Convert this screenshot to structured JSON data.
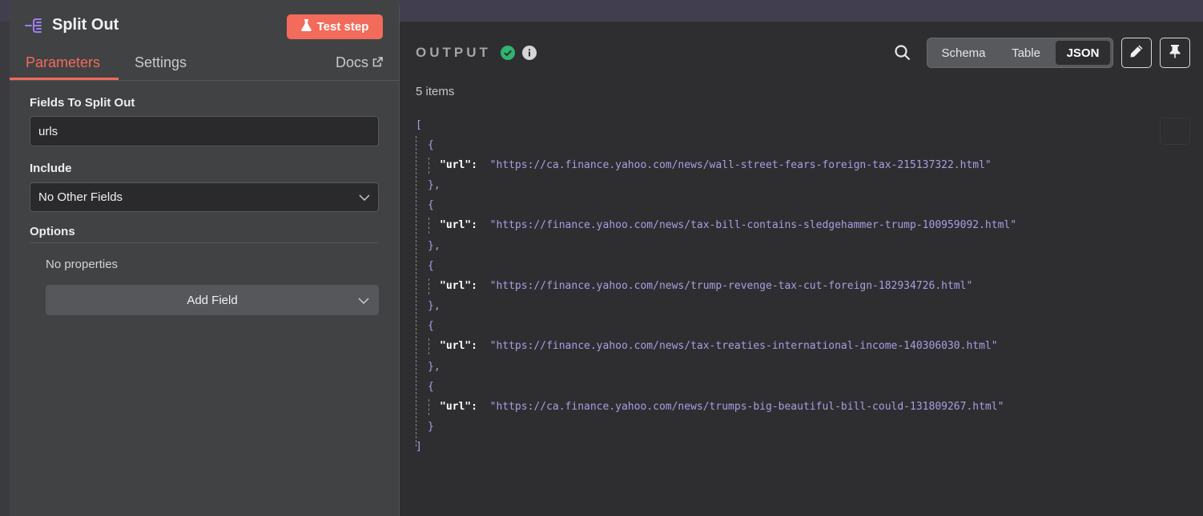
{
  "node": {
    "title": "Split Out",
    "test_step_label": "Test step",
    "tabs": [
      {
        "label": "Parameters",
        "active": true
      },
      {
        "label": "Settings",
        "active": false
      }
    ],
    "docs_label": "Docs",
    "fields": {
      "split_out_label": "Fields To Split Out",
      "split_out_value": "urls",
      "include_label": "Include",
      "include_value": "No Other Fields",
      "options_label": "Options",
      "no_properties": "No properties",
      "add_field_label": "Add Field"
    }
  },
  "output": {
    "title": "OUTPUT",
    "status": "success",
    "view_options": [
      "Schema",
      "Table",
      "JSON"
    ],
    "active_view": "JSON",
    "items_count": "5 items",
    "items": [
      {
        "key": "\"url\":",
        "value": "\"https://ca.finance.yahoo.com/news/wall-street-fears-foreign-tax-215137322.html\""
      },
      {
        "key": "\"url\":",
        "value": "\"https://finance.yahoo.com/news/tax-bill-contains-sledgehammer-trump-100959092.html\""
      },
      {
        "key": "\"url\":",
        "value": "\"https://finance.yahoo.com/news/trump-revenge-tax-cut-foreign-182934726.html\""
      },
      {
        "key": "\"url\":",
        "value": "\"https://finance.yahoo.com/news/tax-treaties-international-income-140306030.html\""
      },
      {
        "key": "\"url\":",
        "value": "\"https://ca.finance.yahoo.com/news/trumps-big-beautiful-bill-could-131809267.html\""
      }
    ],
    "punctuation": {
      "open_array": "[",
      "close_array": "]",
      "open_obj": "{",
      "close_obj_comma": "},",
      "close_obj": "}"
    }
  },
  "colors": {
    "accent": "#f26b5b",
    "success": "#2fb36f",
    "json_string": "#a69fe0"
  }
}
